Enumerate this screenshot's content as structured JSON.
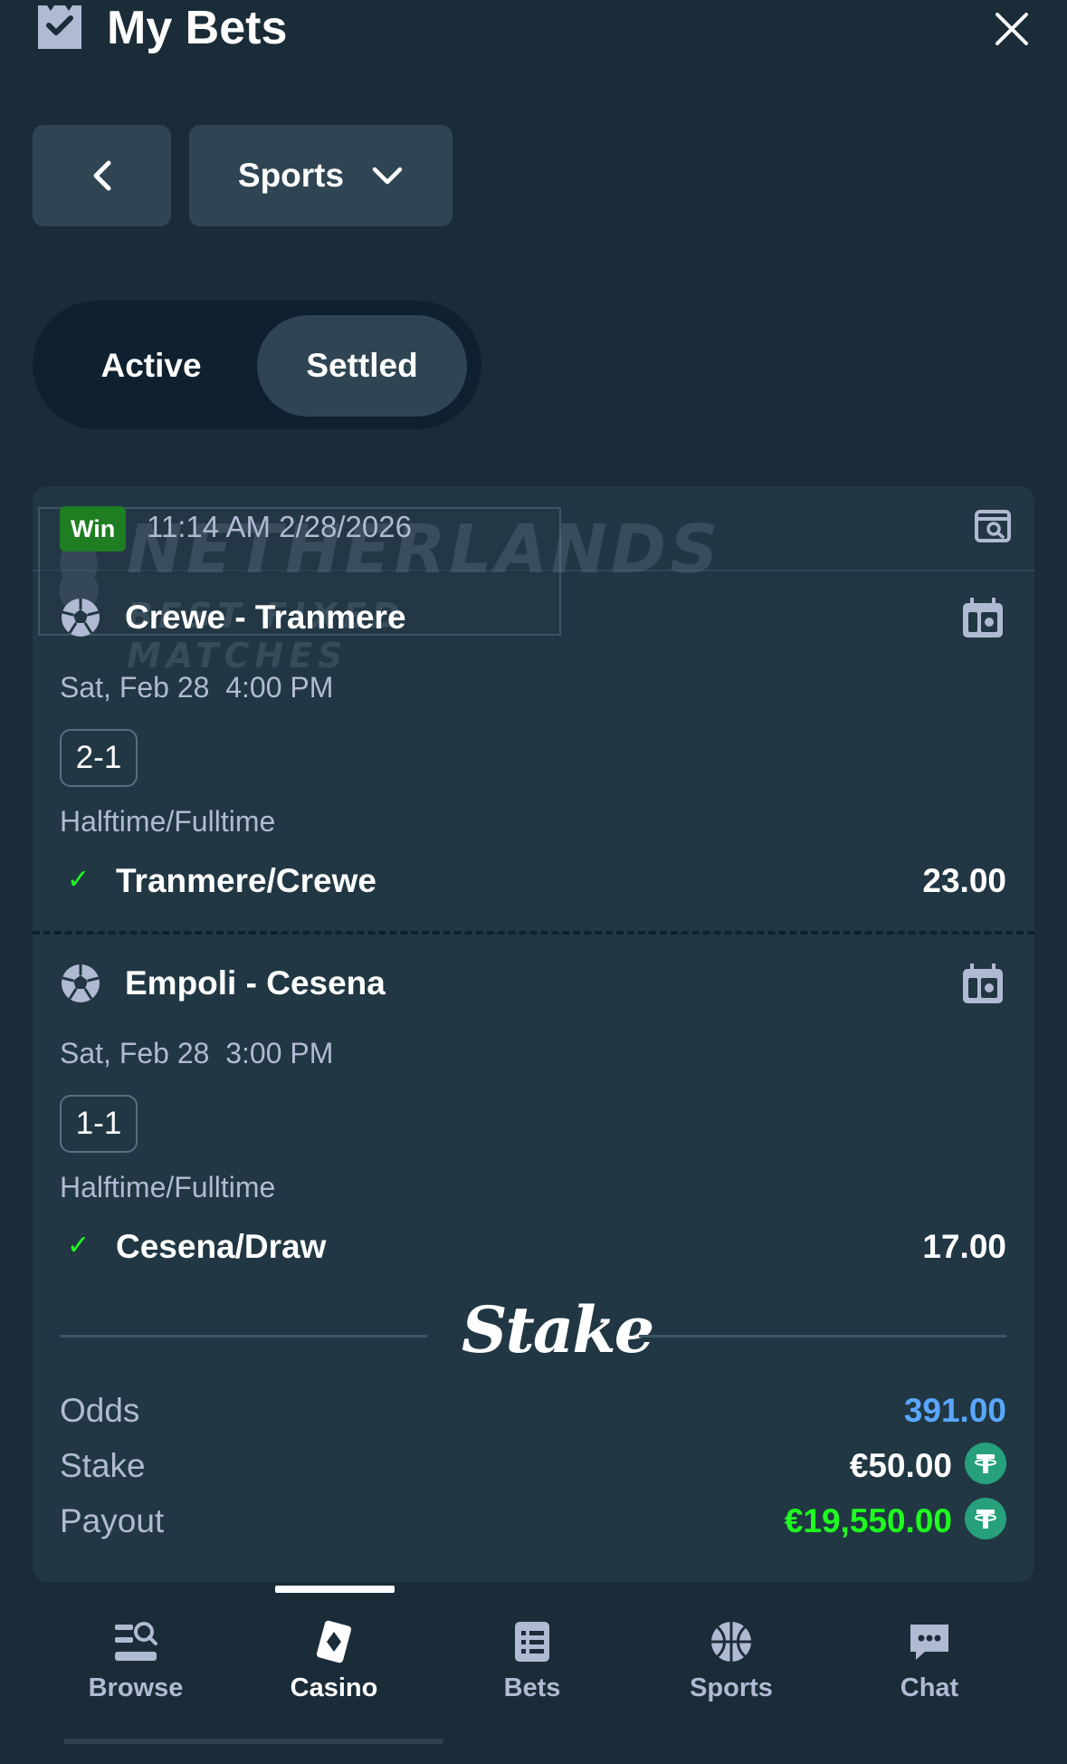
{
  "header": {
    "title": "My Bets"
  },
  "filters": {
    "category_label": "Sports"
  },
  "tabs": {
    "active_label": "Active",
    "settled_label": "Settled",
    "selected": "Settled"
  },
  "bet": {
    "status": "Win",
    "timestamp": "11:14 AM 2/28/2026",
    "legs": [
      {
        "match": "Crewe - Tranmere",
        "date": "Sat, Feb 28",
        "time": "4:00 PM",
        "score": "2-1",
        "market": "Halftime/Fulltime",
        "selection": "Tranmere/Crewe",
        "odds": "23.00"
      },
      {
        "match": "Empoli - Cesena",
        "date": "Sat, Feb 28",
        "time": "3:00 PM",
        "score": "1-1",
        "market": "Halftime/Fulltime",
        "selection": "Cesena/Draw",
        "odds": "17.00"
      }
    ],
    "brand": "Stake",
    "summary": {
      "odds_label": "Odds",
      "odds_value": "391.00",
      "stake_label": "Stake",
      "stake_value": "€50.00",
      "payout_label": "Payout",
      "payout_value": "€19,550.00"
    }
  },
  "watermark": {
    "line1": "NETHERLANDS",
    "line2": "BEST FIXED MATCHES"
  },
  "nav": {
    "items": [
      {
        "label": "Browse",
        "icon": "browse-icon"
      },
      {
        "label": "Casino",
        "icon": "casino-icon"
      },
      {
        "label": "Bets",
        "icon": "bets-icon"
      },
      {
        "label": "Sports",
        "icon": "sports-icon"
      },
      {
        "label": "Chat",
        "icon": "chat-icon"
      }
    ],
    "selected": "Casino"
  },
  "colors": {
    "background": "#1a2c38",
    "card": "#213743",
    "button": "#2f4553",
    "win_green": "#1f7d22",
    "payout_green": "#1fff20",
    "odds_blue": "#5aa7ff",
    "muted_text": "#b1bad3",
    "usdt_green": "#26a17b"
  }
}
